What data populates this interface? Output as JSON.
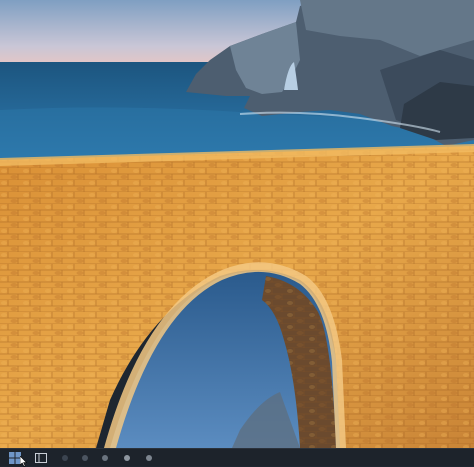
{
  "wallpaper": {
    "subject": "stone-arch-bridge-over-sea",
    "colors": {
      "sky_top": "#8aa8c8",
      "sky_horizon": "#e8c8c0",
      "sea_far": "#1e5a86",
      "sea_near": "#2a74a6",
      "stone_light": "#e6a545",
      "stone_dark": "#a85f1c",
      "cliff": "#5d6e7e"
    }
  },
  "taskbar": {
    "items": [
      {
        "name": "start-button",
        "icon": "windows-logo-icon"
      },
      {
        "name": "task-view-button",
        "icon": "task-view-icon"
      },
      {
        "name": "taskbar-app-1",
        "icon": "app-icon"
      },
      {
        "name": "taskbar-app-2",
        "icon": "app-icon"
      },
      {
        "name": "taskbar-app-3",
        "icon": "app-icon"
      },
      {
        "name": "taskbar-app-4",
        "icon": "app-icon"
      },
      {
        "name": "taskbar-app-5",
        "icon": "app-icon"
      }
    ],
    "background": "#1d232b"
  }
}
